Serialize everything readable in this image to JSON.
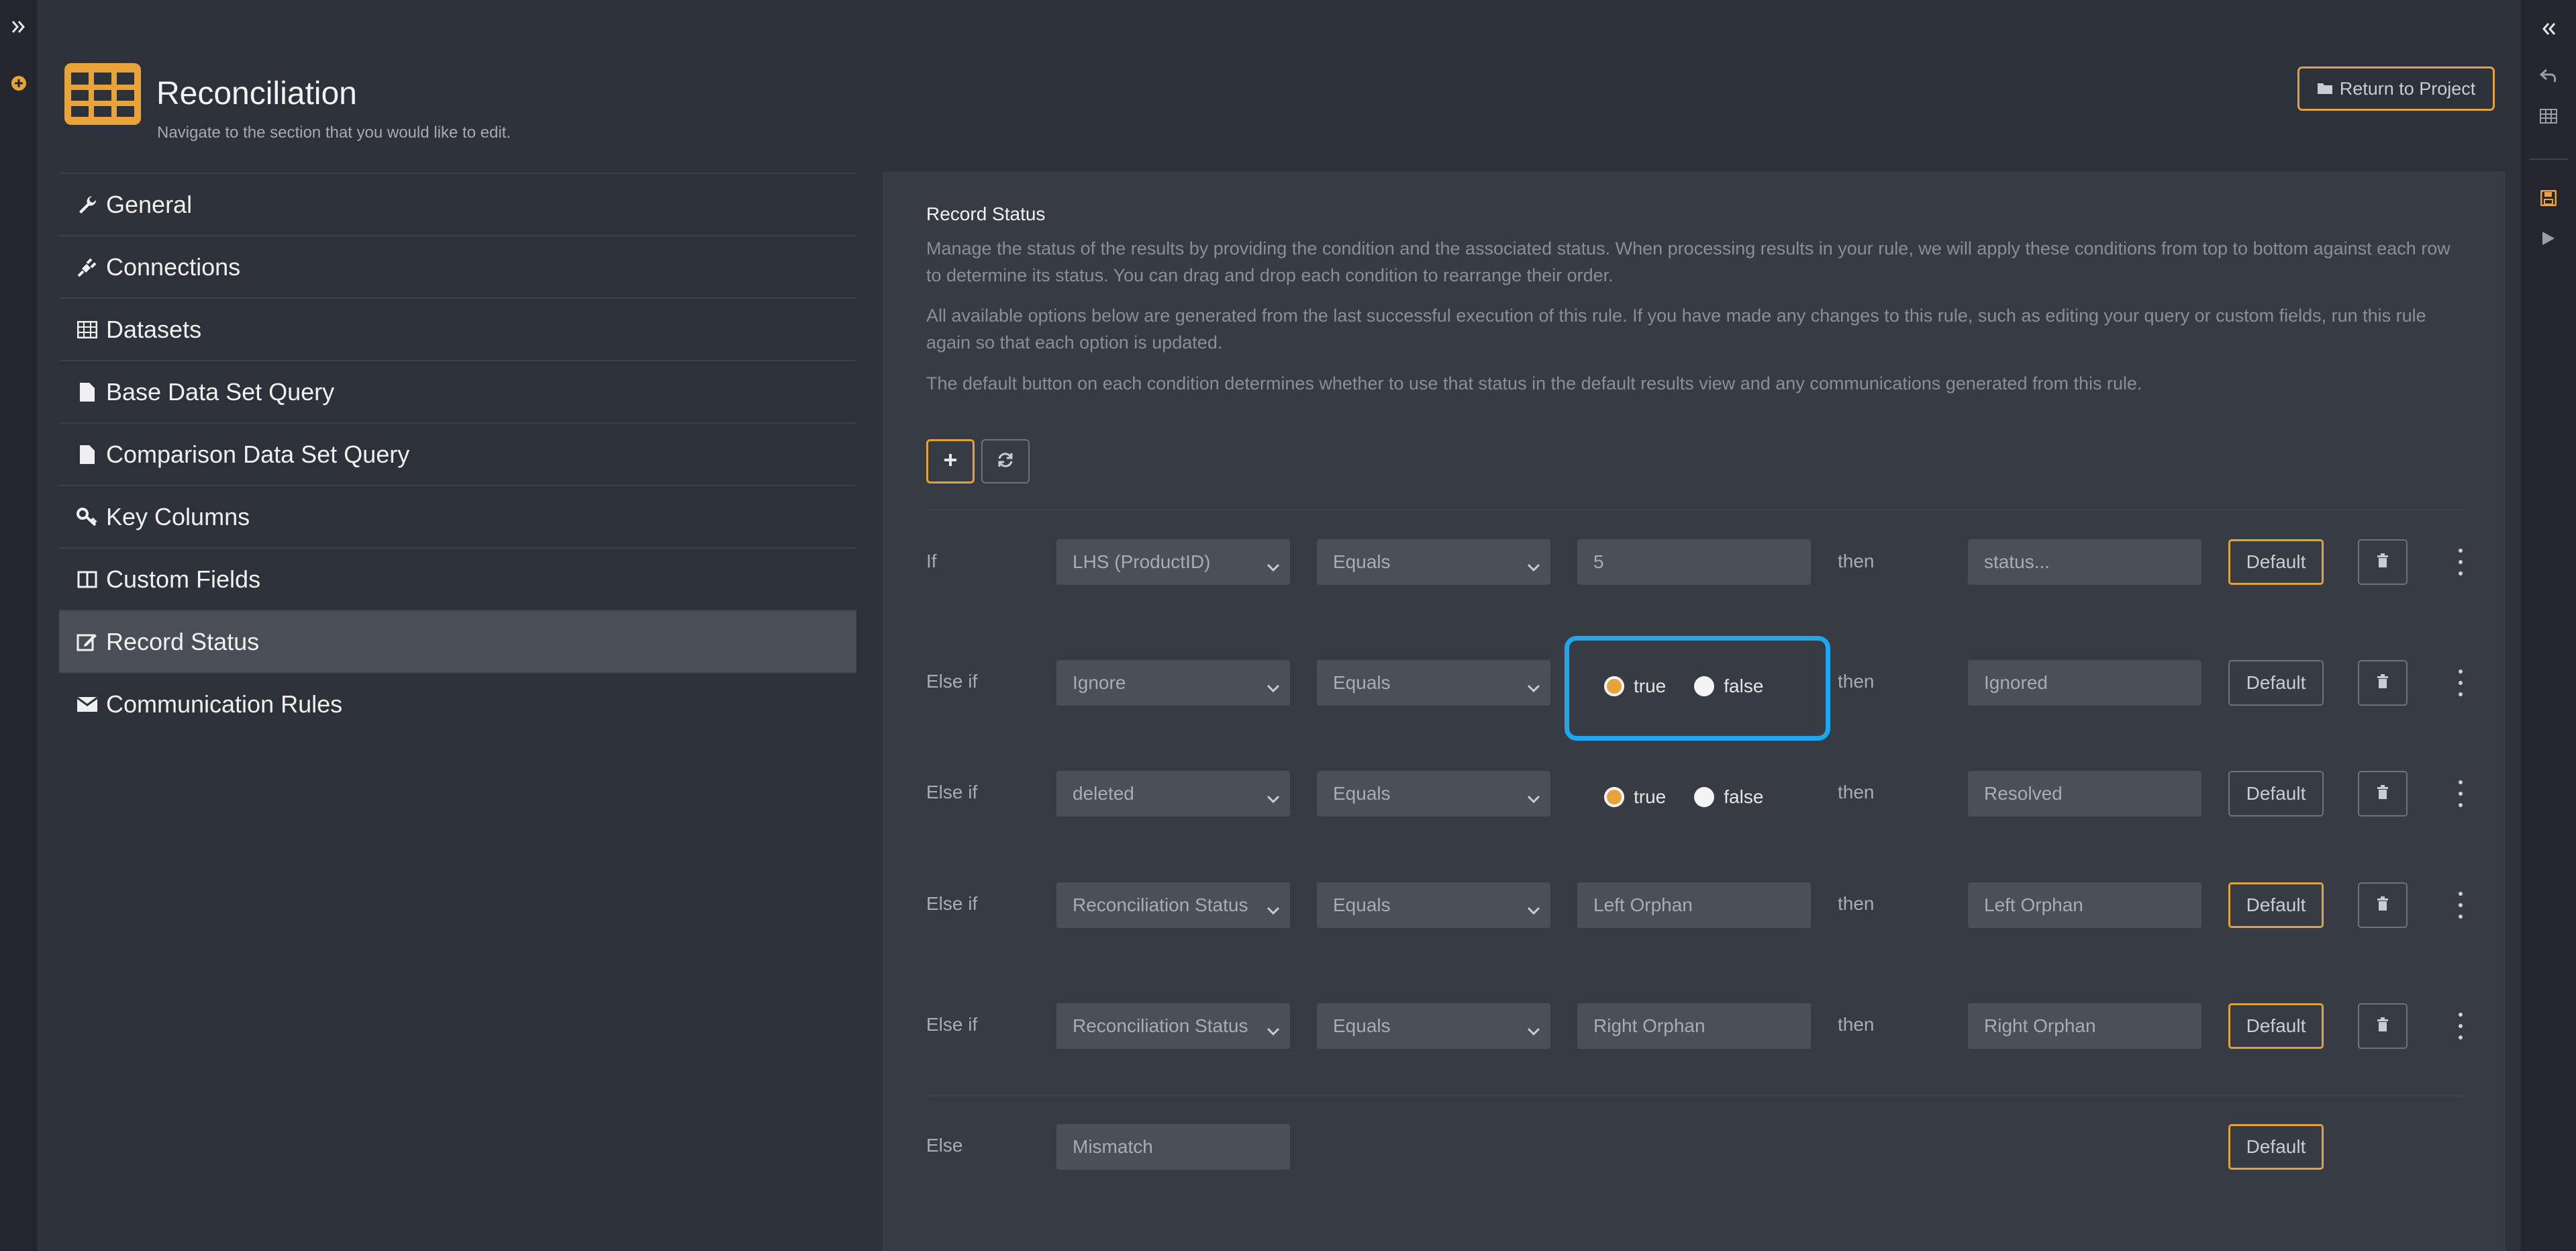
{
  "header": {
    "title": "Reconciliation",
    "subtitle": "Navigate to the section that you would like to edit.",
    "return_label": "Return to Project"
  },
  "nav": {
    "items": [
      {
        "label": "General",
        "icon": "wrench-icon"
      },
      {
        "label": "Connections",
        "icon": "plug-icon"
      },
      {
        "label": "Datasets",
        "icon": "table-icon"
      },
      {
        "label": "Base Data Set Query",
        "icon": "file-icon"
      },
      {
        "label": "Comparison Data Set Query",
        "icon": "file-icon"
      },
      {
        "label": "Key Columns",
        "icon": "key-icon"
      },
      {
        "label": "Custom Fields",
        "icon": "columns-icon"
      },
      {
        "label": "Record Status",
        "icon": "edit-icon",
        "active": true
      },
      {
        "label": "Communication Rules",
        "icon": "envelope-icon"
      }
    ]
  },
  "section": {
    "title": "Record Status",
    "p1": "Manage the status of the results by providing the condition and the associated status. When processing results in your rule, we will apply these conditions from top to bottom against each row to determine its status. You can drag and drop each condition to rearrange their order.",
    "p2": "All available options below are generated from the last successful execution of this rule. If you have made any changes to this rule, such as editing your query or custom fields, run this rule again so that each option is updated.",
    "p3": "The default button on each condition determines whether to use that status in the default results view and any communications generated from this rule."
  },
  "conditions": [
    {
      "label": "If",
      "field": "LHS (ProductID)",
      "operator": "Equals",
      "value": "5",
      "then": "then",
      "status_placeholder": "status...",
      "default": "Default",
      "default_on": true
    },
    {
      "label": "Else if",
      "field": "Ignore",
      "operator": "Equals",
      "radio_true": "true",
      "radio_false": "false",
      "selected": "true",
      "then": "then",
      "status": "Ignored",
      "default": "Default",
      "default_on": false
    },
    {
      "label": "Else if",
      "field": "deleted",
      "operator": "Equals",
      "radio_true": "true",
      "radio_false": "false",
      "selected": "true",
      "then": "then",
      "status": "Resolved",
      "default": "Default",
      "default_on": false
    },
    {
      "label": "Else if",
      "field": "Reconciliation Status",
      "operator": "Equals",
      "value": "Left Orphan",
      "then": "then",
      "status": "Left Orphan",
      "default": "Default",
      "default_on": true
    },
    {
      "label": "Else if",
      "field": "Reconciliation Status",
      "operator": "Equals",
      "value": "Right Orphan",
      "then": "then",
      "status": "Right Orphan",
      "default": "Default",
      "default_on": true
    }
  ],
  "else_row": {
    "label": "Else",
    "status": "Mismatch",
    "default": "Default"
  },
  "colors": {
    "accent": "#e0a23c",
    "highlight": "#1ea6ee",
    "background": "#2d313a",
    "panel": "#373b44"
  }
}
